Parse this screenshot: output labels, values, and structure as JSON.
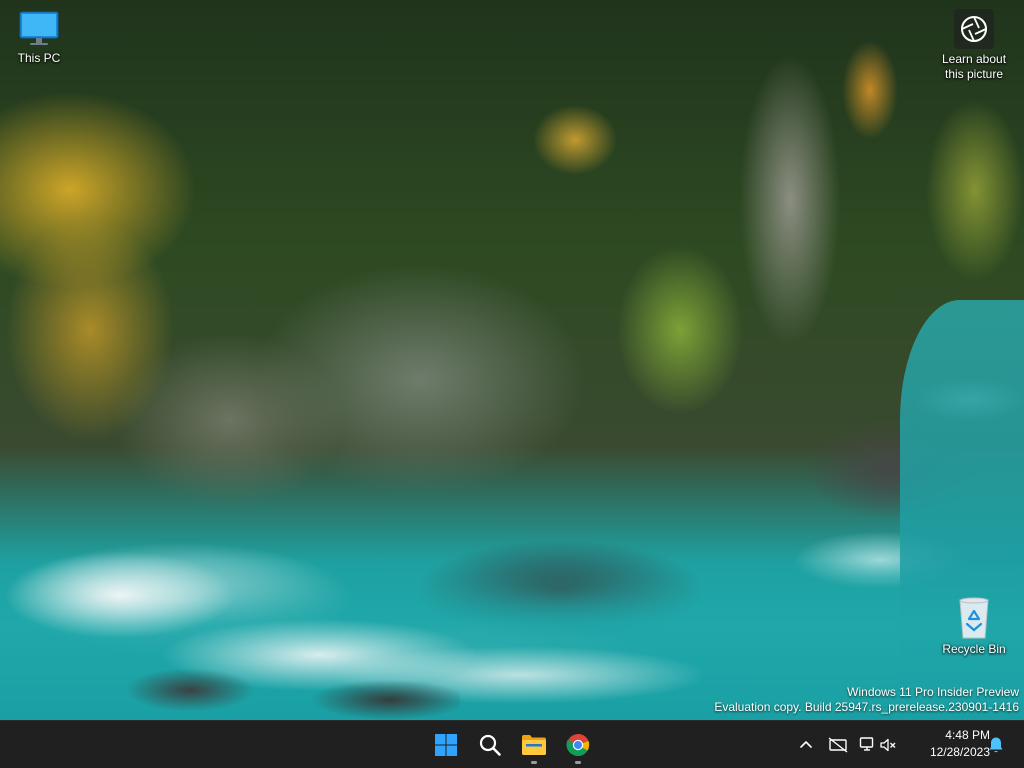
{
  "desktop": {
    "icons": [
      {
        "id": "this-pc",
        "label": "This PC",
        "icon": "monitor-icon"
      },
      {
        "id": "recycle-bin",
        "label": "Recycle Bin",
        "icon": "recycle-bin-icon"
      },
      {
        "id": "learn-about",
        "label": "Learn about\nthis picture",
        "icon": "camera-aperture-icon"
      }
    ],
    "watermark": {
      "line1": "Windows 11 Pro Insider Preview",
      "line2": "Evaluation copy. Build 25947.rs_prerelease.230901-1416"
    }
  },
  "taskbar": {
    "apps": [
      {
        "name": "Start",
        "icon": "windows-start-icon"
      },
      {
        "name": "Search",
        "icon": "search-icon"
      },
      {
        "name": "File Explorer",
        "icon": "folder-icon"
      },
      {
        "name": "Google Chrome",
        "icon": "chrome-icon"
      }
    ],
    "tray": {
      "icons": [
        "chevron-up-icon",
        "network-disconnected-icon",
        "network-icon",
        "volume-muted-icon",
        "bell-icon"
      ],
      "time": "4:48 PM",
      "date": "12/28/2023"
    },
    "colors": {
      "background": "#202020",
      "start_blue": "#2fa4ff",
      "bell_blue": "#4cc2ff"
    }
  }
}
